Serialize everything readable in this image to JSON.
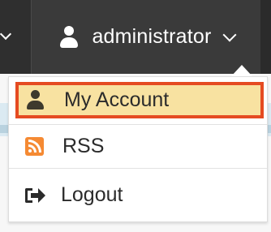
{
  "header": {
    "username": "administrator"
  },
  "menu": {
    "items": [
      {
        "label": "My Account",
        "icon": "user-icon"
      },
      {
        "label": "RSS",
        "icon": "rss-icon"
      },
      {
        "label": "Logout",
        "icon": "logout-icon"
      }
    ]
  },
  "colors": {
    "topbar": "#2b2b2b",
    "selected_background": "#f8e2a1",
    "selected_outline": "#e54b22",
    "rss": "#f58a33"
  }
}
